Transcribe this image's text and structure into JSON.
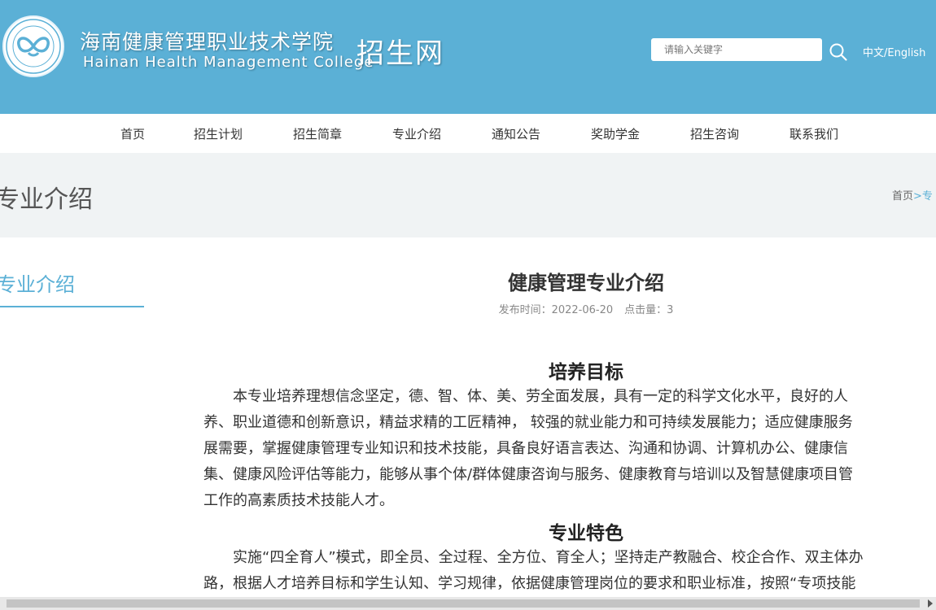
{
  "header": {
    "school_name_cn": "海南健康管理职业技术学院",
    "school_name_en": "Hainan Health Management College",
    "site_name": "招生网",
    "search": {
      "placeholder": "请输入关键字"
    },
    "language": "中文/English",
    "brand_color": "#5bb0d6",
    "icons": [
      "school-emblem-icon",
      "search-icon"
    ]
  },
  "nav": {
    "items": [
      "首页",
      "招生计划",
      "招生简章",
      "专业介绍",
      "通知公告",
      "奖助学金",
      "招生咨询",
      "联系我们"
    ]
  },
  "banner": {
    "title": "专业介绍",
    "breadcrumb": {
      "home": "首页",
      "separator": ">",
      "current": "专"
    }
  },
  "sidebar": {
    "title": "专业介绍"
  },
  "article": {
    "title": "健康管理专业介绍",
    "publish": "发布时间：2022-06-20",
    "clicks": "点击量：3",
    "sections": [
      {
        "heading": "培养目标",
        "lines": [
          "　　本专业培养理想信念坚定，德、智、体、美、劳全面发展，具有一定的科学文化水平，良好的人",
          "养、职业道德和创新意识，精益求精的工匠精神， 较强的就业能力和可持续发展能力；适应健康服务",
          "展需要，掌握健康管理专业知识和技术技能，具备良好语言表达、沟通和协调、计算机办公、健康信",
          "集、健康风险评估等能力，能够从事个体/群体健康咨询与服务、健康教育与培训以及智慧健康项目管",
          "工作的高素质技术技能人才。"
        ]
      },
      {
        "heading": "专业特色",
        "lines": [
          "　　实施“四全育人”模式，即全员、全过程、全方位、育全人；坚持走产教融合、校企合作、双主体办",
          "路，根据人才培养目标和学生认知、学习规律，依据健康管理岗位的要求和职业标准，按照“专项技能"
        ]
      }
    ]
  }
}
